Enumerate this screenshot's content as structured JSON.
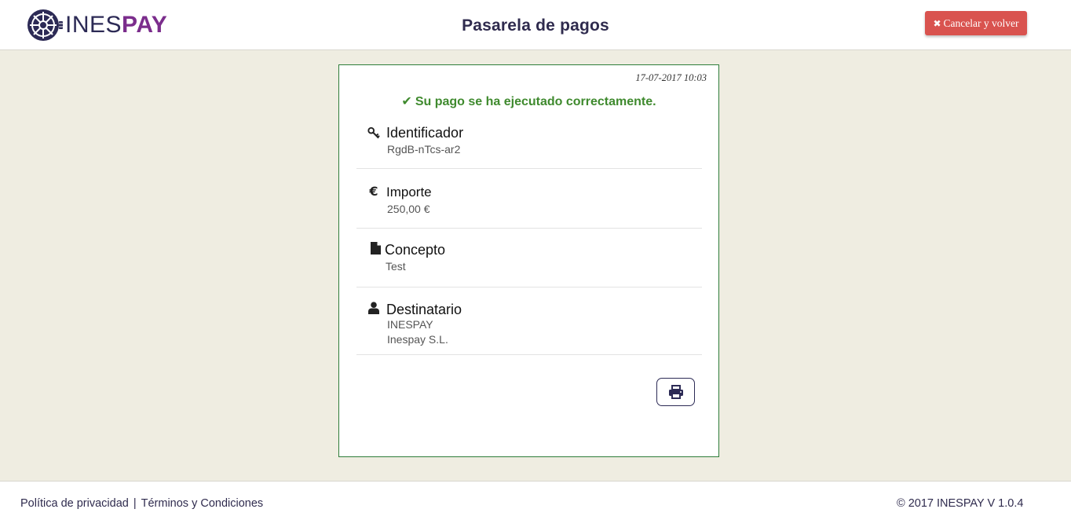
{
  "header": {
    "logo_text_ines": "INES",
    "logo_text_pay": "PAY",
    "title": "Pasarela de pagos",
    "cancel_label": "Cancelar y volver"
  },
  "receipt": {
    "date": "17-07-2017 10:03",
    "success_message": "Su pago se ha ejecutado correctamente.",
    "fields": [
      {
        "label": "Identificador",
        "value": "RgdB-nTcs-ar2",
        "icon": "key-icon"
      },
      {
        "label": "Importe",
        "value": "250,00 €",
        "icon": "euro-icon"
      },
      {
        "label": "Concepto",
        "value": "Test",
        "icon": "file-icon"
      },
      {
        "label": "Destinatario",
        "value_line1": "INESPAY",
        "value_line2": "Inespay S.L.",
        "icon": "user-icon"
      }
    ],
    "print_icon": "print-icon"
  },
  "footer": {
    "privacy_link": "Política de privacidad",
    "separator": "|",
    "terms_link": "Términos y Condiciones",
    "copyright": "© 2017 INESPAY  V 1.0.4"
  },
  "colors": {
    "brand_dark": "#2c2a55",
    "brand_purple": "#7b2d8c",
    "danger": "#d9534f",
    "success": "#3f8a2e",
    "background": "#efede1"
  }
}
